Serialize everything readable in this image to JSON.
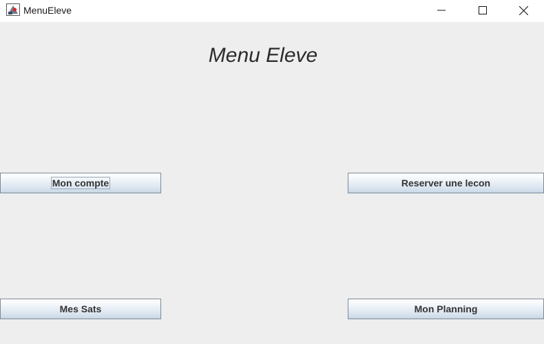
{
  "window": {
    "title": "MenuEleve",
    "icon": "java-app-icon",
    "controls": {
      "minimize": "minimize-icon",
      "maximize": "maximize-icon",
      "close": "close-icon"
    }
  },
  "main": {
    "heading": "Menu Eleve",
    "buttons": {
      "mon_compte": "Mon compte",
      "reserver_lecon": "Reserver une lecon",
      "mes_sats": "Mes Sats",
      "mon_planning": "Mon Planning"
    }
  },
  "colors": {
    "background": "#eeeeee",
    "button_border": "#7a8a99",
    "button_gradient_bottom": "#c9d7e6",
    "text": "#333333"
  }
}
